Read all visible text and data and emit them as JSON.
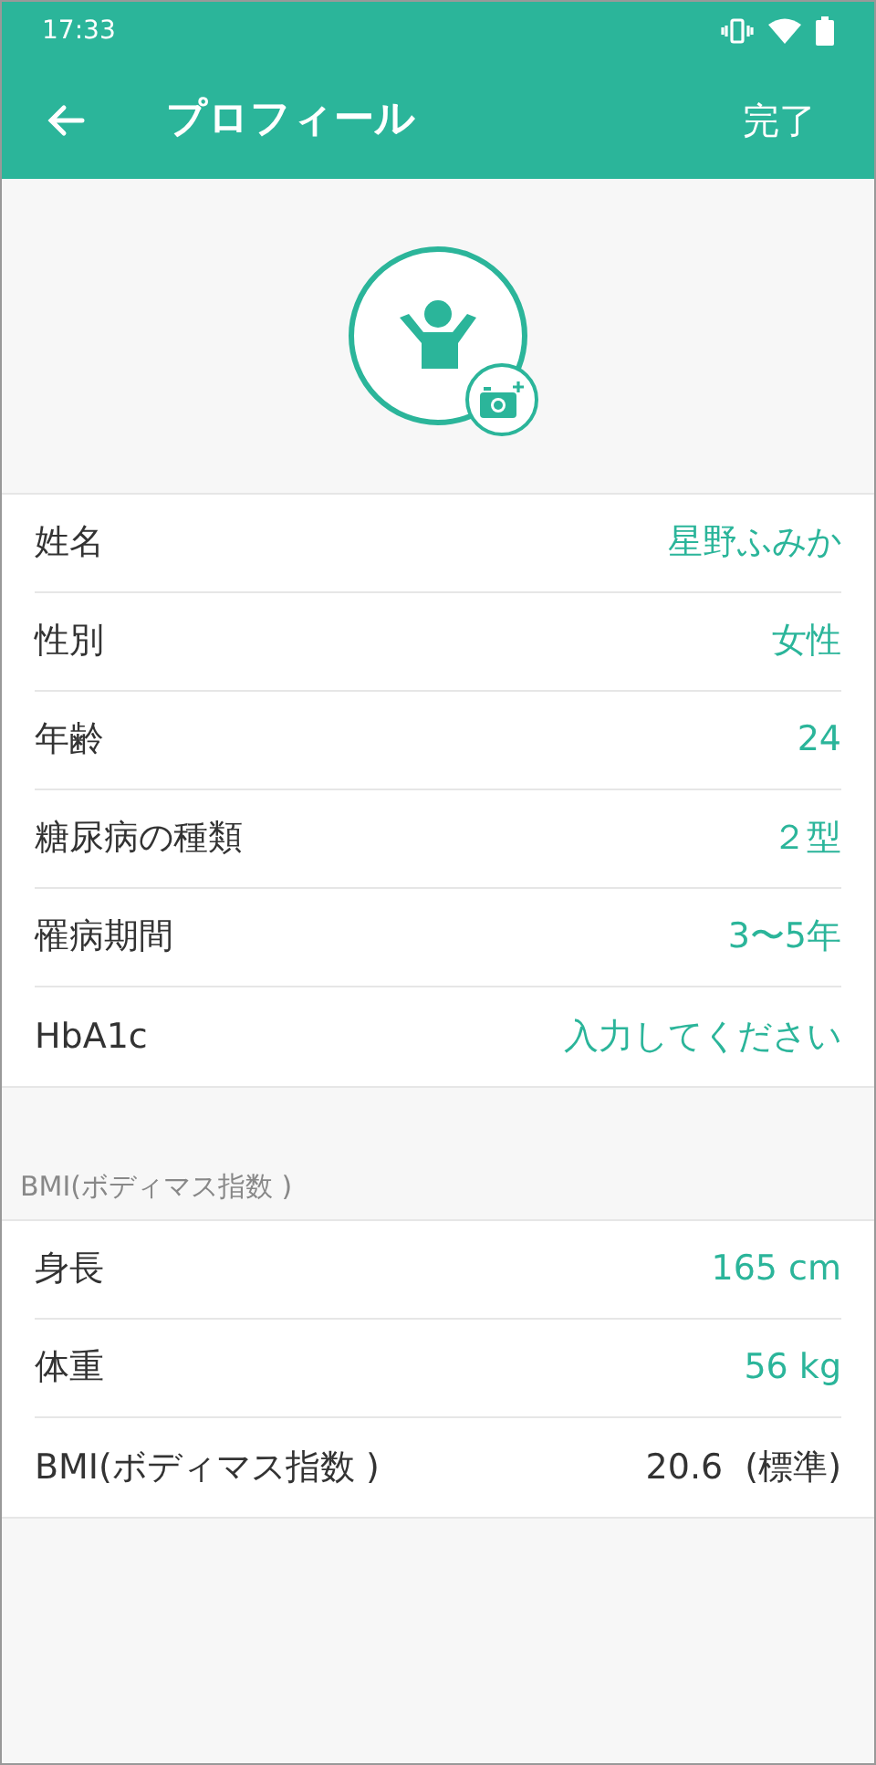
{
  "status_bar": {
    "time": "17:33"
  },
  "app_bar": {
    "title": "プロフィール",
    "action": "完了"
  },
  "profile_rows": [
    {
      "label": "姓名",
      "value": "星野ふみか",
      "kind": "input"
    },
    {
      "label": "性別",
      "value": "女性",
      "kind": "input"
    },
    {
      "label": "年齢",
      "value": "24",
      "kind": "input"
    },
    {
      "label": "糖尿病の種類",
      "value": "２型",
      "kind": "input"
    },
    {
      "label": "罹病期間",
      "value": "3〜5年",
      "kind": "input"
    },
    {
      "label": "HbA1c",
      "value": "入力してください",
      "kind": "input"
    }
  ],
  "bmi_section": {
    "header": "BMI(ボディマス指数 )",
    "rows": [
      {
        "label": "身長",
        "value": "165 cm",
        "kind": "input"
      },
      {
        "label": "体重",
        "value": "56 kg",
        "kind": "input"
      },
      {
        "label": "BMI(ボディマス指数 )",
        "value": "20.6  (標準)",
        "kind": "computed"
      }
    ]
  }
}
